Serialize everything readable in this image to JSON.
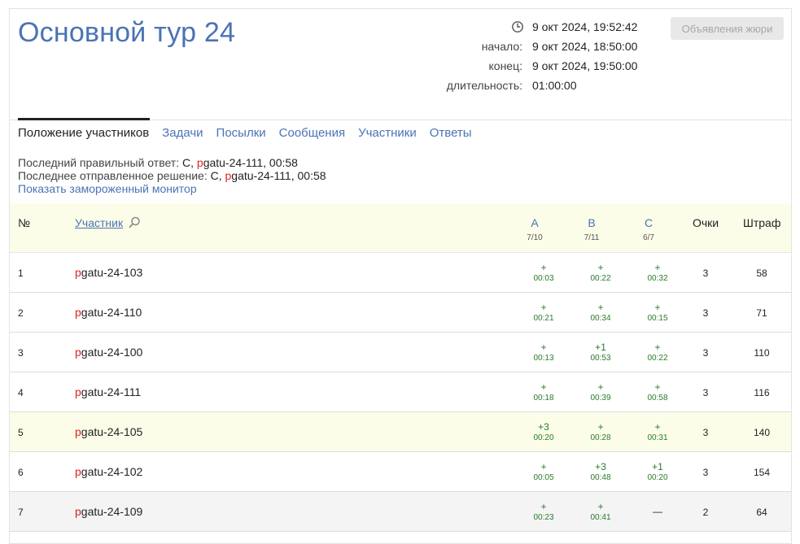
{
  "header": {
    "title": "Основной тур 24",
    "current_time": "9 окт 2024, 19:52:42",
    "start_label": "начало:",
    "start_value": "9 окт 2024, 18:50:00",
    "end_label": "конец:",
    "end_value": "9 окт 2024, 19:50:00",
    "duration_label": "длительность:",
    "duration_value": "01:00:00",
    "jury_button": "Объявления жюри"
  },
  "tabs": [
    {
      "label": "Положение участников",
      "active": true
    },
    {
      "label": "Задачи"
    },
    {
      "label": "Посылки"
    },
    {
      "label": "Сообщения"
    },
    {
      "label": "Участники"
    },
    {
      "label": "Ответы"
    }
  ],
  "last_info": {
    "correct_label": "Последний правильный ответ:",
    "correct_problem": "C,",
    "correct_user_prefix": "p",
    "correct_user_rest": "gatu-24-111,",
    "correct_time": "00:58",
    "submitted_label": "Последнее отправленное решение:",
    "submitted_problem": "C,",
    "submitted_user_prefix": "p",
    "submitted_user_rest": "gatu-24-111,",
    "submitted_time": "00:58",
    "frozen_link": "Показать замороженный монитор"
  },
  "table": {
    "col_num": "№",
    "col_participant": "Участник",
    "col_points": "Очки",
    "col_penalty": "Штраф",
    "problems": [
      {
        "letter": "A",
        "ratio": "7/10"
      },
      {
        "letter": "B",
        "ratio": "7/11"
      },
      {
        "letter": "C",
        "ratio": "6/7"
      }
    ],
    "rows": [
      {
        "num": "1",
        "prefix": "p",
        "name": "gatu-24-103",
        "results": [
          {
            "mark": "+",
            "time": "00:03"
          },
          {
            "mark": "+",
            "time": "00:22"
          },
          {
            "mark": "+",
            "time": "00:32"
          }
        ],
        "points": "3",
        "penalty": "58"
      },
      {
        "num": "2",
        "prefix": "p",
        "name": "gatu-24-110",
        "results": [
          {
            "mark": "+",
            "time": "00:21"
          },
          {
            "mark": "+",
            "time": "00:34"
          },
          {
            "mark": "+",
            "time": "00:15"
          }
        ],
        "points": "3",
        "penalty": "71"
      },
      {
        "num": "3",
        "prefix": "p",
        "name": "gatu-24-100",
        "results": [
          {
            "mark": "+",
            "time": "00:13"
          },
          {
            "mark": "+1",
            "time": "00:53"
          },
          {
            "mark": "+",
            "time": "00:22"
          }
        ],
        "points": "3",
        "penalty": "110"
      },
      {
        "num": "4",
        "prefix": "p",
        "name": "gatu-24-111",
        "results": [
          {
            "mark": "+",
            "time": "00:18"
          },
          {
            "mark": "+",
            "time": "00:39"
          },
          {
            "mark": "+",
            "time": "00:58"
          }
        ],
        "points": "3",
        "penalty": "116"
      },
      {
        "num": "5",
        "prefix": "p",
        "name": "gatu-24-105",
        "results": [
          {
            "mark": "+3",
            "time": "00:20"
          },
          {
            "mark": "+",
            "time": "00:28"
          },
          {
            "mark": "+",
            "time": "00:31"
          }
        ],
        "points": "3",
        "penalty": "140"
      },
      {
        "num": "6",
        "prefix": "p",
        "name": "gatu-24-102",
        "results": [
          {
            "mark": "+",
            "time": "00:05"
          },
          {
            "mark": "+3",
            "time": "00:48"
          },
          {
            "mark": "+1",
            "time": "00:20"
          }
        ],
        "points": "3",
        "penalty": "154"
      },
      {
        "num": "7",
        "prefix": "p",
        "name": "gatu-24-109",
        "results": [
          {
            "mark": "+",
            "time": "00:23"
          },
          {
            "mark": "+",
            "time": "00:41"
          },
          {
            "mark": "—",
            "time": ""
          }
        ],
        "points": "2",
        "penalty": "64"
      }
    ]
  },
  "colors": {
    "accent": "#4a73b5",
    "accepted": "#2b7a2b",
    "highlight_row": "#fcfde8",
    "muted_row": "#f4f4f4",
    "prefix_red": "#e02020"
  },
  "icons": {
    "clock": "clock-icon",
    "search": "search-icon"
  }
}
